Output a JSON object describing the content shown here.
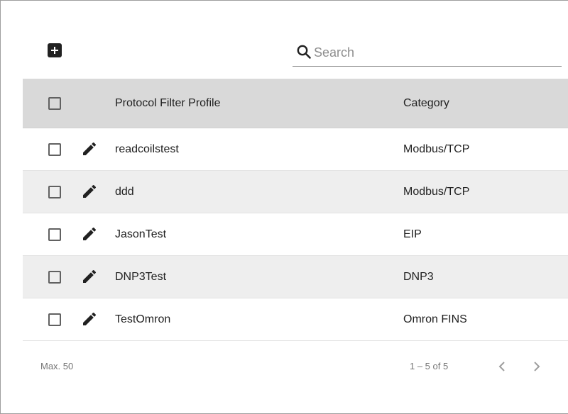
{
  "toolbar": {
    "add_icon": "plus-box-icon",
    "search_placeholder": "Search",
    "search_value": ""
  },
  "table": {
    "headers": {
      "name": "Protocol Filter Profile",
      "category": "Category"
    },
    "rows": [
      {
        "name": "readcoilstest",
        "category": "Modbus/TCP"
      },
      {
        "name": "ddd",
        "category": "Modbus/TCP"
      },
      {
        "name": "JasonTest",
        "category": "EIP"
      },
      {
        "name": "DNP3Test",
        "category": "DNP3"
      },
      {
        "name": "TestOmron",
        "category": "Omron FINS"
      }
    ]
  },
  "footer": {
    "max_label": "Max. 50",
    "range_label": "1 – 5 of 5",
    "prev_icon": "chevron-left-icon",
    "next_icon": "chevron-right-icon"
  },
  "colors": {
    "header_bg": "#d9d9d9",
    "alt_row_bg": "#eeeeee",
    "icon": "#212121",
    "muted_text": "#757575"
  }
}
